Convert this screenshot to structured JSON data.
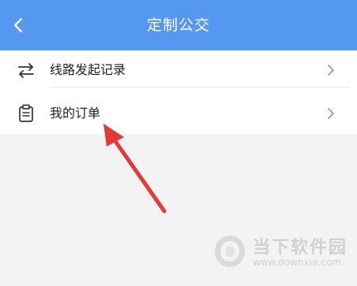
{
  "header": {
    "title": "定制公交",
    "back_icon": "chevron-left-icon",
    "background": "#5598f0"
  },
  "menu": {
    "items": [
      {
        "label": "线路发起记录",
        "icon": "route-swap-icon"
      },
      {
        "label": "我的订单",
        "icon": "clipboard-icon"
      }
    ]
  },
  "annotation": {
    "color": "#e53935",
    "target": "我的订单"
  },
  "watermark": {
    "brand": "当下软件园",
    "url": "www.downxia.com"
  }
}
